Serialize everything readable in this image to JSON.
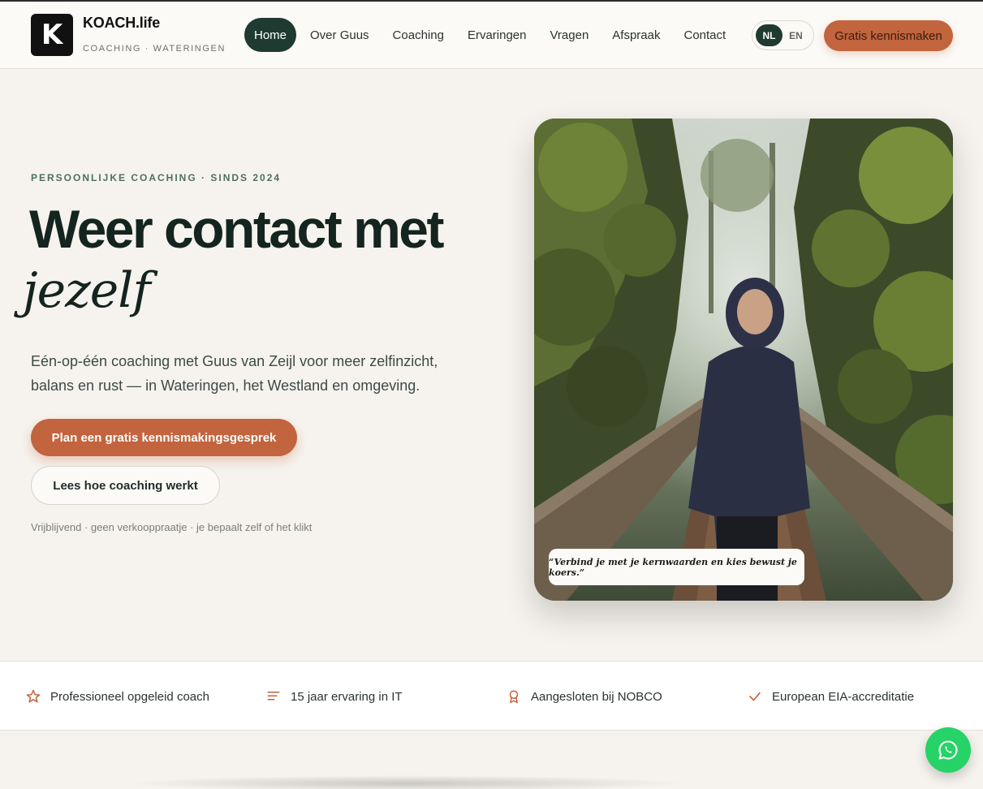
{
  "brand": {
    "logo_letter": "K",
    "name": "KOACH.life",
    "tagline": "COACHING · WATERINGEN"
  },
  "nav": {
    "items": [
      {
        "label": "Home",
        "active": true
      },
      {
        "label": "Over Guus"
      },
      {
        "label": "Coaching"
      },
      {
        "label": "Ervaringen"
      },
      {
        "label": "Vragen"
      },
      {
        "label": "Afspraak"
      },
      {
        "label": "Contact"
      }
    ],
    "lang": {
      "nl": "NL",
      "en": "EN",
      "selected": "NL"
    },
    "cta": "Gratis kennismaken"
  },
  "hero": {
    "eyebrow": "PERSOONLIJKE COACHING · SINDS 2024",
    "title": "Weer contact met",
    "title_italic": "jezelf",
    "description": "Eén-op-één coaching met Guus van Zeijl voor meer zelfinzicht, balans en rust — in Wateringen, het Westland en omgeving.",
    "primary_button": "Plan een gratis kennismakingsgesprek",
    "secondary_button": "Lees hoe coaching werkt",
    "note": "Vrijblijvend · geen verkooppraatje · je bepaalt zelf of het klikt"
  },
  "photo": {
    "quote": "“Verbind je met je kernwaarden en kies bewust je koers.”"
  },
  "features": [
    {
      "icon": "star-icon",
      "label": "Professioneel opgeleid coach"
    },
    {
      "icon": "lines-icon",
      "label": "15 jaar ervaring in IT"
    },
    {
      "icon": "award-icon",
      "label": "Aangesloten bij NOBCO"
    },
    {
      "icon": "check-icon",
      "label": "European EIA-accreditatie"
    }
  ],
  "colors": {
    "accent": "#c2643d",
    "dark_green": "#1f3a31",
    "background": "#f6f3ee",
    "whatsapp": "#25d366"
  }
}
